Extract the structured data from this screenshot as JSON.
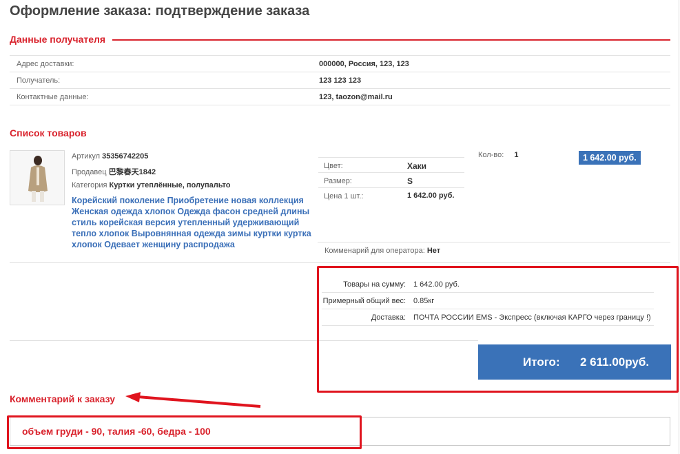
{
  "page": {
    "title": "Оформление заказа: подтверждение заказа"
  },
  "recipient": {
    "heading": "Данные получателя",
    "rows": [
      {
        "label": "Адрес доставки:",
        "value": "000000, Россия, 123, 123"
      },
      {
        "label": "Получатель:",
        "value": "123 123 123"
      },
      {
        "label": "Контактные данные:",
        "value": "123, taozon@mail.ru"
      }
    ]
  },
  "products": {
    "heading": "Список товаров",
    "item": {
      "article_label": "Артикул",
      "article": "35356742205",
      "seller_label": "Продавец",
      "seller": "巴黎春天1842",
      "category_label": "Категория",
      "category": "Куртки утеплённые, полупальто",
      "description": "Корейский поколение Приобретение новая коллекция Женская одежда хлопок Одежда фасон средней длины стиль корейская версия утепленный удерживающий тепло хлопок Выровнянная одежда зимы куртки куртка хлопок Одевает женщину распродажа",
      "attributes": [
        {
          "label": "Цвет:",
          "value": "Хаки"
        },
        {
          "label": "Размер:",
          "value": "S"
        },
        {
          "label": "Цена 1 шт.:",
          "value": "1 642.00 руб."
        }
      ],
      "qty_label": "Кол-во:",
      "qty": "1",
      "price": "1 642.00 руб.",
      "operator_comment_label": "Комменарий для оператора:",
      "operator_comment": "Нет"
    }
  },
  "summary": {
    "rows": [
      {
        "label": "Товары на сумму:",
        "value": "1 642.00 руб."
      },
      {
        "label": "Примерный общий вес:",
        "value": "0.85кг"
      },
      {
        "label": "Доставка:",
        "value": "ПОЧТА РОССИИ EMS - Экспресс (включая КАРГО через границу !)"
      }
    ],
    "total_label": "Итого:",
    "total_value": "2 611.00руб."
  },
  "order_comment": {
    "heading": "Комментарий к заказу",
    "value": "объем груди - 90, талия -60, бедра - 100"
  },
  "colors": {
    "accent_red": "#d9232d",
    "highlight_red": "#e0141e",
    "brand_blue": "#3a72b8",
    "link_blue": "#3a6fb8"
  }
}
